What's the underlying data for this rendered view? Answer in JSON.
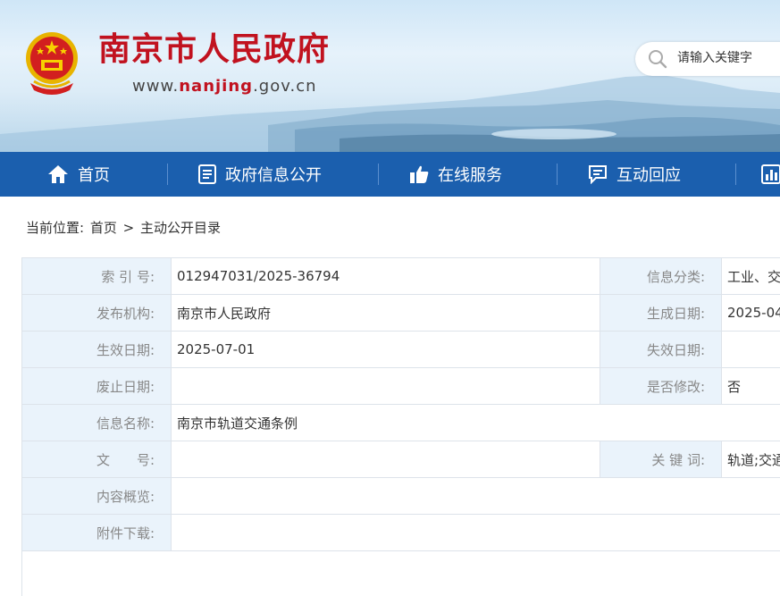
{
  "header": {
    "site_title": "南京市人民政府",
    "url_prefix": "www.",
    "url_domain": "nanjing",
    "url_suffix": ".gov.cn",
    "brand_color": "#c1121f"
  },
  "search": {
    "placeholder": "请输入关键字",
    "icon": "search-icon"
  },
  "nav": {
    "background": "#1b5fae",
    "items": [
      {
        "label": "首页",
        "icon": "home-icon"
      },
      {
        "label": "政府信息公开",
        "icon": "document-icon"
      },
      {
        "label": "在线服务",
        "icon": "thumbs-up-icon"
      },
      {
        "label": "互动回应",
        "icon": "chat-icon"
      },
      {
        "label": "",
        "icon": "chart-icon"
      }
    ]
  },
  "breadcrumb": {
    "prefix": "当前位置:",
    "items": [
      "首页",
      ">",
      "主动公开目录"
    ]
  },
  "info": {
    "rows": [
      {
        "label": "索 引 号:",
        "value": "012947031/2025-36794",
        "label2": "信息分类:",
        "value2": "工业、交"
      },
      {
        "label": "发布机构:",
        "value": "南京市人民政府",
        "label2": "生成日期:",
        "value2": "2025-04"
      },
      {
        "label": "生效日期:",
        "value": "2025-07-01",
        "label2": "失效日期:",
        "value2": ""
      },
      {
        "label": "废止日期:",
        "value": "",
        "label2": "是否修改:",
        "value2": "否"
      },
      {
        "label": "信息名称:",
        "value": "南京市轨道交通条例"
      },
      {
        "label": "文　　号:",
        "value": "",
        "label2": "关 键 词:",
        "value2": "轨道;交通"
      },
      {
        "label": "内容概览:",
        "value": ""
      },
      {
        "label": "附件下载:",
        "value": ""
      }
    ]
  }
}
